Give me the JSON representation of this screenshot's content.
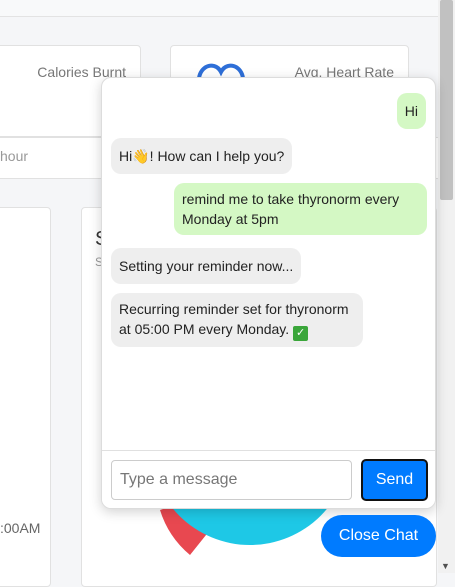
{
  "dashboard": {
    "calories_label": "Calories Burnt",
    "heart_label": "Avg. Heart Rate",
    "hour_label": "hour",
    "axis_time": ":00AM",
    "panel_title_fragment": "S",
    "panel_subtitle_fragment": "S"
  },
  "chat": {
    "messages": [
      {
        "role": "user",
        "text": "Hi"
      },
      {
        "role": "bot",
        "text_before": "Hi",
        "icon": "waving-hand-icon",
        "text_after": "! How can I help you?"
      },
      {
        "role": "user",
        "text": "remind me to take thyronorm every Monday at 5pm"
      },
      {
        "role": "bot",
        "text": "Setting your reminder now..."
      },
      {
        "role": "bot",
        "text": "Recurring reminder set for thyronorm at 05:00 PM every Monday.",
        "icon": "check-mark-icon"
      }
    ],
    "input": {
      "placeholder": "Type a message",
      "value": ""
    },
    "send_label": "Send",
    "close_label": "Close Chat"
  },
  "colors": {
    "accent": "#007bff",
    "user_bubble": "#d4f8c4",
    "bot_bubble": "#eeeeee",
    "pie_blue": "#1ec8e6",
    "pie_red": "#e84850",
    "heart_icon": "#2e6fd8"
  }
}
